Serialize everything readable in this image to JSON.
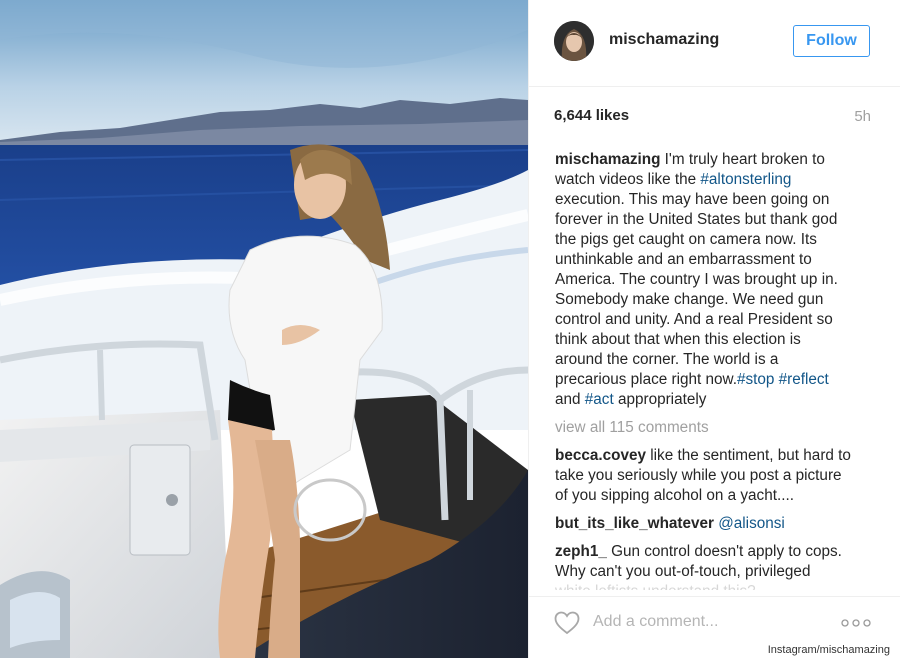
{
  "post": {
    "username": "mischamazing",
    "follow_label": "Follow",
    "likes": "6,644 likes",
    "time": "5h"
  },
  "caption": {
    "username": "mischamazing",
    "lines": [
      "I'm truly heart broken to",
      "watch videos like the ",
      "execution. This may have been going on",
      "forever in the United States but thank god",
      "the pigs get caught on camera now. Its",
      "unthinkable and an embarrassment to",
      "America. The country I was brought up in.",
      "Somebody make change. We need gun",
      "control and unity. And a real President so",
      "think about that when this election is",
      "around the corner. The world is a",
      "precarious place right now.",
      "and ",
      " appropriately"
    ],
    "tags": [
      "#altonsterling",
      "#stop",
      "#reflect",
      "#act"
    ]
  },
  "view_all": "view all 115 comments",
  "comments": [
    {
      "user": "becca.covey",
      "lines": [
        " like the sentiment, but hard to",
        "take you seriously while you post a picture",
        "of you sipping alcohol on a yacht...."
      ]
    },
    {
      "user": "but_its_like_whatever",
      "mention": "@alisonsi"
    },
    {
      "user": "zeph1_",
      "lines": [
        " Gun control doesn't apply to cops.",
        "Why can't you out-of-touch, privileged",
        "white leftists understand this?"
      ]
    }
  ],
  "footer": {
    "add_comment_placeholder": "Add a comment..."
  },
  "credit": "Instagram/mischamazing",
  "colors": {
    "follow_blue": "#3897f0",
    "hashtag": "#125688",
    "muted": "#a0a0a0"
  },
  "icons": [
    "heart-icon",
    "more-options-icon"
  ]
}
